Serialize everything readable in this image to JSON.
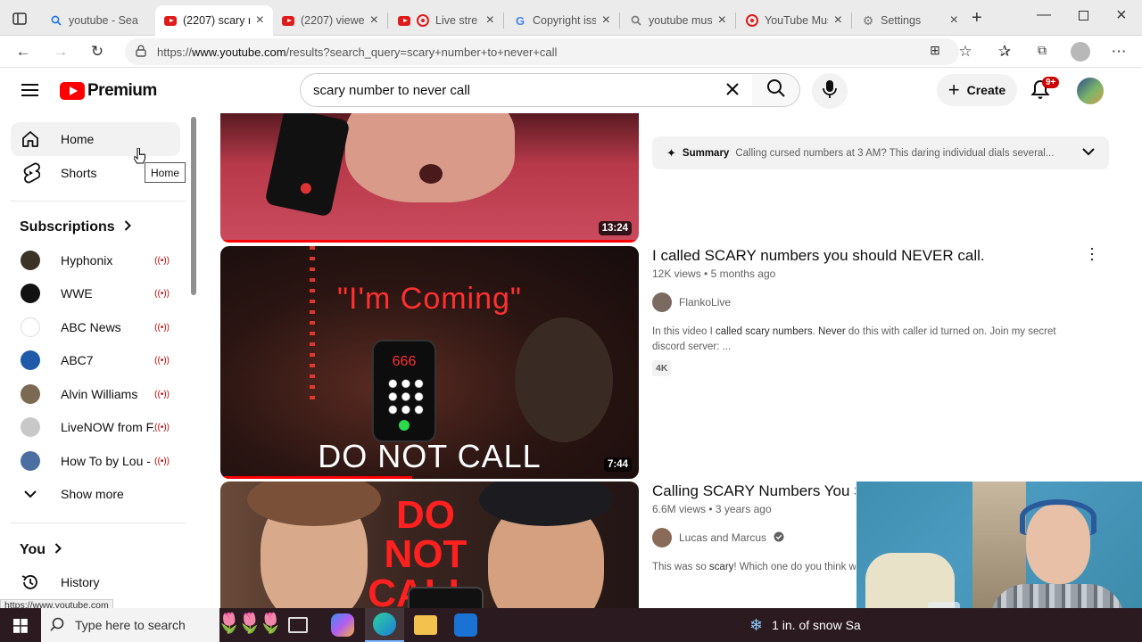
{
  "browser": {
    "tabs": [
      {
        "title": "youtube - Sea",
        "icon": "search-icon"
      },
      {
        "title": "(2207) scary n",
        "icon": "youtube-icon",
        "active": true
      },
      {
        "title": "(2207) viewer",
        "icon": "youtube-icon"
      },
      {
        "title": "Live stre",
        "icon": "youtube-live-icon"
      },
      {
        "title": "Copyright iss",
        "icon": "google-icon"
      },
      {
        "title": "youtube mus",
        "icon": "search-icon"
      },
      {
        "title": "YouTube Mus",
        "icon": "youtube-music-icon"
      },
      {
        "title": "Settings",
        "icon": "gear-icon"
      }
    ],
    "url_prefix": "https://",
    "url_host": "www.youtube.com",
    "url_path": "/results?search_query=scary+number+to+never+call"
  },
  "header": {
    "logo_text": "Premium",
    "search_value": "scary number to never call",
    "create_label": "Create",
    "notification_count": "9+"
  },
  "sidebar": {
    "items": [
      {
        "label": "Home",
        "icon": "home-icon"
      },
      {
        "label": "Shorts",
        "icon": "shorts-icon"
      }
    ],
    "subscriptions_heading": "Subscriptions",
    "subscriptions": [
      {
        "name": "Hyphonix",
        "color": "#3a3326"
      },
      {
        "name": "WWE",
        "color": "#111111"
      },
      {
        "name": "ABC News",
        "color": "#ffffff"
      },
      {
        "name": "ABC7",
        "color": "#1e5aa8"
      },
      {
        "name": "Alvin Williams",
        "color": "#7a6a52"
      },
      {
        "name": "LiveNOW from F...",
        "color": "#c8c8c8"
      },
      {
        "name": "How To by Lou - ...",
        "color": "#4a6fa0"
      }
    ],
    "show_more": "Show more",
    "you_heading": "You",
    "history": "History",
    "tooltip": "Home"
  },
  "results": [
    {
      "duration": "13:24",
      "summary_label": "Summary",
      "summary_text": "Calling cursed numbers at 3 AM? This daring individual dials several..."
    },
    {
      "title": "I called SCARY numbers you should NEVER call.",
      "views": "12K views",
      "age": "5 months ago",
      "channel": "FlankoLive",
      "desc_pre": "In this video I ",
      "desc_b1": "called scary numbers",
      "desc_mid": ". ",
      "desc_b2": "Never",
      "desc_post": " do this with caller id turned on. Join my secret discord server: ...",
      "badge": "4K",
      "duration": "7:44",
      "thumb_top_text": "\"I'm Coming\"",
      "thumb_number": "666",
      "thumb_bottom_text": "DO NOT CALL"
    },
    {
      "title": "Calling SCARY Numbers You Sh",
      "views": "6.6M views",
      "age": "3 years ago",
      "channel": "Lucas and Marcus",
      "desc_pre": "This was so ",
      "desc_b1": "scary",
      "desc_post": "! Which one do you think wa",
      "thumb_text_1": "DO NOT",
      "thumb_text_2": "CALL."
    }
  ],
  "status_url": "https://www.youtube.com",
  "taskbar": {
    "search_placeholder": "Type here to search",
    "weather": "1 in. of snow Sa"
  }
}
